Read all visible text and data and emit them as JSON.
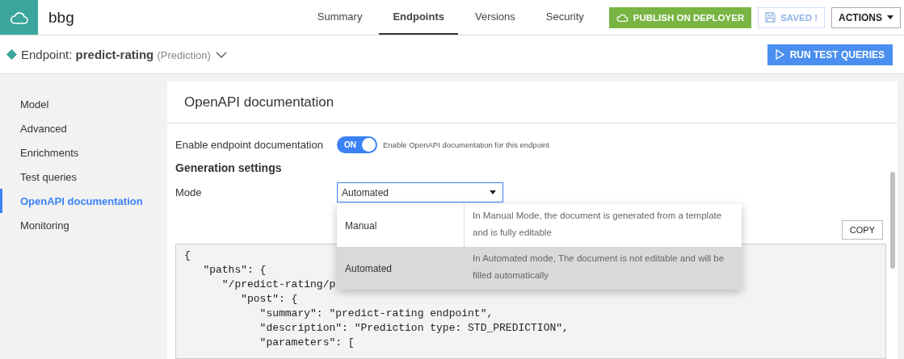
{
  "app": {
    "name": "bbg"
  },
  "nav_tabs": [
    {
      "label": "Summary",
      "selected": false
    },
    {
      "label": "Endpoints",
      "selected": true
    },
    {
      "label": "Versions",
      "selected": false
    },
    {
      "label": "Security",
      "selected": false
    }
  ],
  "header_buttons": {
    "publish": "PUBLISH ON DEPLOYER",
    "saved": {
      "label": "SAVED !",
      "disabled": true
    },
    "actions": "ACTIONS"
  },
  "endpoint": {
    "prefix": "Endpoint:",
    "name": "predict-rating",
    "type": "(Prediction)"
  },
  "run_button": "RUN TEST QUERIES",
  "sidebar": {
    "items": [
      {
        "label": "Model",
        "selected": false
      },
      {
        "label": "Advanced",
        "selected": false
      },
      {
        "label": "Enrichments",
        "selected": false
      },
      {
        "label": "Test queries",
        "selected": false
      },
      {
        "label": "OpenAPI documentation",
        "selected": true
      },
      {
        "label": "Monitoring",
        "selected": false
      }
    ]
  },
  "panel": {
    "title": "OpenAPI documentation",
    "enable": {
      "label": "Enable endpoint documentation",
      "on": true,
      "toggle_text": "ON",
      "hint": "Enable OpenAPI documentation for this endpoint"
    },
    "section": "Generation settings",
    "mode": {
      "label": "Mode",
      "value": "Automated",
      "options": [
        {
          "label": "Manual",
          "description": "In Manual Mode, the document is generated from a template and is fully editable",
          "selected": false
        },
        {
          "label": "Automated",
          "description": "In Automated mode, The document is not editable and will be filled automatically",
          "selected": true
        }
      ]
    },
    "copy": "COPY",
    "code_lines": [
      "{",
      "   \"paths\": {",
      "      \"/predict-rating/p",
      "         \"post\": {",
      "            \"summary\": \"predict-rating endpoint\",",
      "            \"description\": \"Prediction type: STD_PREDICTION\",",
      "            \"parameters\": ["
    ]
  }
}
